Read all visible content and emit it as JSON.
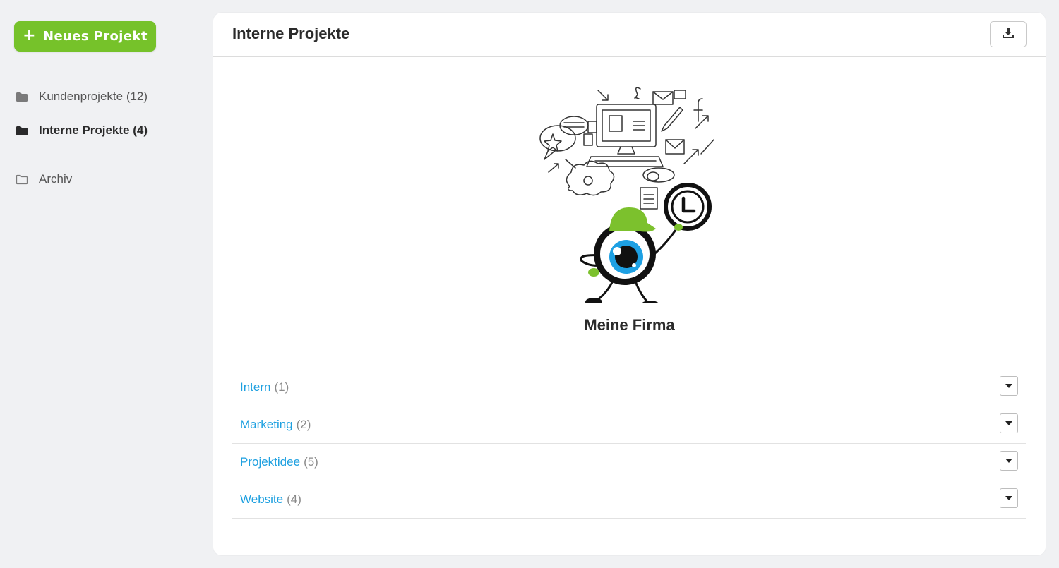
{
  "sidebar": {
    "new_project_label": "Neues Projekt",
    "items": [
      {
        "label": "Kundenprojekte (12)",
        "icon": "folder-filled-icon",
        "active": false
      },
      {
        "label": "Interne Projekte (4)",
        "icon": "folder-filled-icon",
        "active": true
      },
      {
        "label": "Archiv",
        "icon": "folder-outline-icon",
        "active": false
      }
    ]
  },
  "main": {
    "title": "Interne Projekte",
    "download_icon": "download-icon",
    "company_name": "Meine Firma",
    "groups": [
      {
        "name": "Intern",
        "count": "(1)"
      },
      {
        "name": "Marketing",
        "count": "(2)"
      },
      {
        "name": "Projektidee",
        "count": "(5)"
      },
      {
        "name": "Website",
        "count": "(4)"
      }
    ]
  },
  "colors": {
    "accent_green": "#76c22a",
    "link_blue": "#1ea0e0",
    "background": "#f0f1f3"
  }
}
